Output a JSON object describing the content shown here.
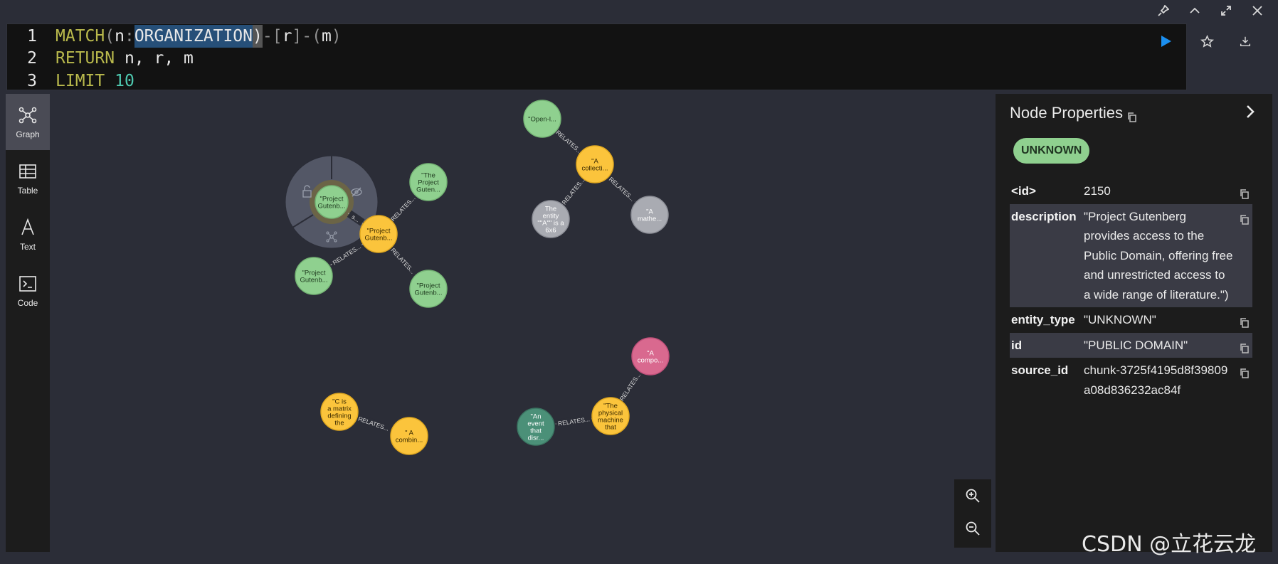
{
  "editor": {
    "lines": [
      {
        "no": "1",
        "kw": "MATCH",
        "p1": " (",
        "var1": "n",
        "colon": ":",
        "label": "ORGANIZATION",
        "p2": ")",
        "rest": "-[",
        "rvar": "r",
        "p3": "]-(",
        "mvar": "m",
        "p4": ")"
      },
      {
        "no": "2",
        "kw": "RETURN",
        "rest": " n, r, m"
      },
      {
        "no": "3",
        "kw": "LIMIT",
        "num": "10"
      }
    ],
    "run_icon": "play-icon",
    "favorite_icon": "star-icon",
    "download_icon": "download-icon"
  },
  "window_controls": [
    "pin-icon",
    "collapse-up-icon",
    "expand-icon",
    "close-icon"
  ],
  "sidebar": {
    "items": [
      {
        "label": "Graph",
        "icon": "graph-icon",
        "active": true
      },
      {
        "label": "Table",
        "icon": "table-icon",
        "active": false
      },
      {
        "label": "Text",
        "icon": "text-icon",
        "active": false
      },
      {
        "label": "Code",
        "icon": "code-icon",
        "active": false
      }
    ]
  },
  "colors": {
    "green": "#8fd08f",
    "orange": "#fbc43c",
    "gray": "#a9abb2",
    "pink": "#d9698f",
    "teal": "#4b9078"
  },
  "graph": {
    "nodes": [
      {
        "id": "pg_sel",
        "lines": [
          "\"Project",
          "Gutenb..."
        ],
        "color": "green"
      },
      {
        "id": "the_proj",
        "lines": [
          "\"The",
          "Project",
          "Guten..."
        ],
        "color": "green"
      },
      {
        "id": "pg_center",
        "lines": [
          "\"Project",
          "Gutenb..."
        ],
        "color": "orange"
      },
      {
        "id": "pg_left",
        "lines": [
          "\"Project",
          "Gutenb..."
        ],
        "color": "green"
      },
      {
        "id": "pg_right",
        "lines": [
          "\"Project",
          "Gutenb..."
        ],
        "color": "green"
      },
      {
        "id": "open_l",
        "lines": [
          "\"Open-l..."
        ],
        "color": "green"
      },
      {
        "id": "a_collect",
        "lines": [
          "\"A",
          "collecti..."
        ],
        "color": "orange"
      },
      {
        "id": "entity",
        "lines": [
          "The",
          "entity",
          "\"\"A\"\" is a",
          "6x6"
        ],
        "color": "gray"
      },
      {
        "id": "a_mathe",
        "lines": [
          "\"A",
          "mathe..."
        ],
        "color": "gray"
      },
      {
        "id": "a_compo",
        "lines": [
          "\"A",
          "compo..."
        ],
        "color": "pink"
      },
      {
        "id": "physical",
        "lines": [
          "\"The",
          "physical",
          "machine",
          "that"
        ],
        "color": "orange"
      },
      {
        "id": "an_event",
        "lines": [
          "\"An",
          "event",
          "that",
          "disr..."
        ],
        "color": "teal"
      },
      {
        "id": "c_matrix",
        "lines": [
          "\"C is",
          "a matrix",
          "defining",
          "the"
        ],
        "color": "orange"
      },
      {
        "id": "a_combin",
        "lines": [
          "\" A",
          "combin..."
        ],
        "color": "orange"
      }
    ],
    "edges": [
      {
        "from": "pg_center",
        "to": "pg_sel",
        "label": "s..."
      },
      {
        "from": "pg_center",
        "to": "the_proj",
        "label": "RELATES..."
      },
      {
        "from": "pg_center",
        "to": "pg_left",
        "label": "RELATES..."
      },
      {
        "from": "pg_center",
        "to": "pg_right",
        "label": "RELATES..."
      },
      {
        "from": "a_collect",
        "to": "open_l",
        "label": "RELATES..."
      },
      {
        "from": "a_collect",
        "to": "entity",
        "label": "RELATES..."
      },
      {
        "from": "a_collect",
        "to": "a_mathe",
        "label": "RELATES..."
      },
      {
        "from": "physical",
        "to": "a_compo",
        "label": "RELATES..."
      },
      {
        "from": "physical",
        "to": "an_event",
        "label": "RELATES..."
      },
      {
        "from": "c_matrix",
        "to": "a_combin",
        "label": "RELATES..."
      }
    ],
    "ring_menu_icons": [
      "unlock-icon",
      "hide-icon",
      "expand-graph-icon"
    ]
  },
  "zoom": {
    "in_icon": "zoom-in-icon",
    "out_icon": "zoom-out-icon"
  },
  "properties": {
    "title": "Node Properties",
    "badge": "UNKNOWN",
    "rows": [
      {
        "key": "<id>",
        "value": "2150"
      },
      {
        "key": "description",
        "value": "\"Project Gutenberg provides access to the Public Domain, offering free and unrestricted access to a wide range of literature.\")"
      },
      {
        "key": "entity_type",
        "value": "\"UNKNOWN\""
      },
      {
        "key": "id",
        "value": "\"PUBLIC DOMAIN\""
      },
      {
        "key": "source_id",
        "value": "chunk-3725f4195d8f39809a08d836232ac84f"
      }
    ]
  },
  "watermark": "CSDN @立花云龙"
}
